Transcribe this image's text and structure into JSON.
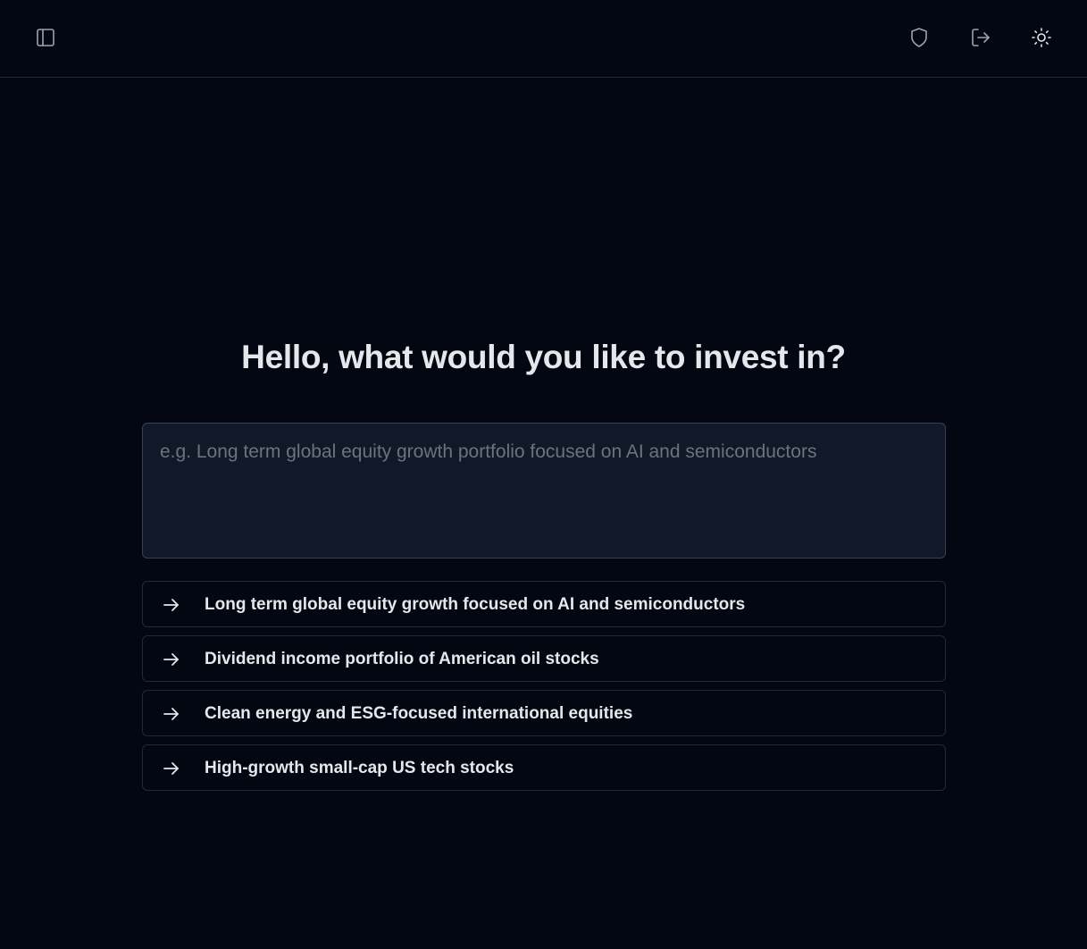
{
  "header": {
    "icons": {
      "sidebar_toggle": "panel-left-icon",
      "security": "shield-icon",
      "logout": "log-out-icon",
      "theme": "sun-icon"
    }
  },
  "main": {
    "heading": "Hello, what would you like to invest in?",
    "prompt": {
      "value": "",
      "placeholder": "e.g. Long term global equity growth portfolio focused on AI and semiconductors"
    },
    "suggestions": [
      {
        "label": "Long term global equity growth focused on AI and semiconductors"
      },
      {
        "label": "Dividend income portfolio of American oil stocks"
      },
      {
        "label": "Clean energy and ESG-focused international equities"
      },
      {
        "label": "High-growth small-cap US tech stocks"
      }
    ]
  },
  "colors": {
    "background": "#030712",
    "surface": "#111827",
    "border": "#1f2937",
    "text": "#e5e7eb",
    "placeholder": "#6b7280"
  }
}
